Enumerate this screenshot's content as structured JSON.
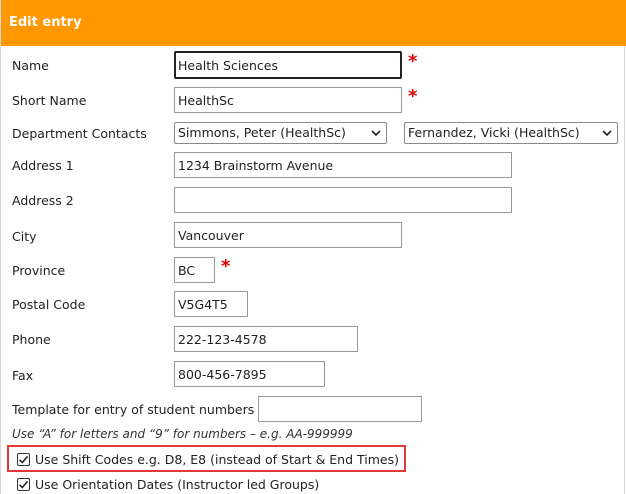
{
  "header": {
    "title": "Edit entry"
  },
  "form": {
    "name": {
      "label": "Name",
      "value": "Health Sciences"
    },
    "short_name": {
      "label": "Short Name",
      "value": "HealthSc"
    },
    "department_contacts": {
      "label": "Department Contacts",
      "contact1": "Simmons, Peter (HealthSc)",
      "contact2": "Fernandez, Vicki (HealthSc)"
    },
    "address1": {
      "label": "Address 1",
      "value": "1234 Brainstorm Avenue"
    },
    "address2": {
      "label": "Address 2",
      "value": ""
    },
    "city": {
      "label": "City",
      "value": "Vancouver"
    },
    "province": {
      "label": "Province",
      "value": "BC"
    },
    "postal_code": {
      "label": "Postal Code",
      "value": "V5G4T5"
    },
    "phone": {
      "label": "Phone",
      "value": "222-123-4578"
    },
    "fax": {
      "label": "Fax",
      "value": "800-456-7895"
    },
    "template": {
      "label": "Template for entry of student numbers",
      "value": "",
      "hint": "Use “A” for letters and “9” for numbers – e.g. AA-999999"
    },
    "shift_codes": {
      "label": "Use Shift Codes e.g. D8, E8 (instead of Start & End Times)",
      "checked": true
    },
    "orientation_dates": {
      "label": "Use Orientation Dates (Instructor led Groups)",
      "checked": true
    },
    "required_mark": "*"
  },
  "colors": {
    "header": "#ff9800",
    "required": "#e00000",
    "highlight": "#e53935"
  }
}
